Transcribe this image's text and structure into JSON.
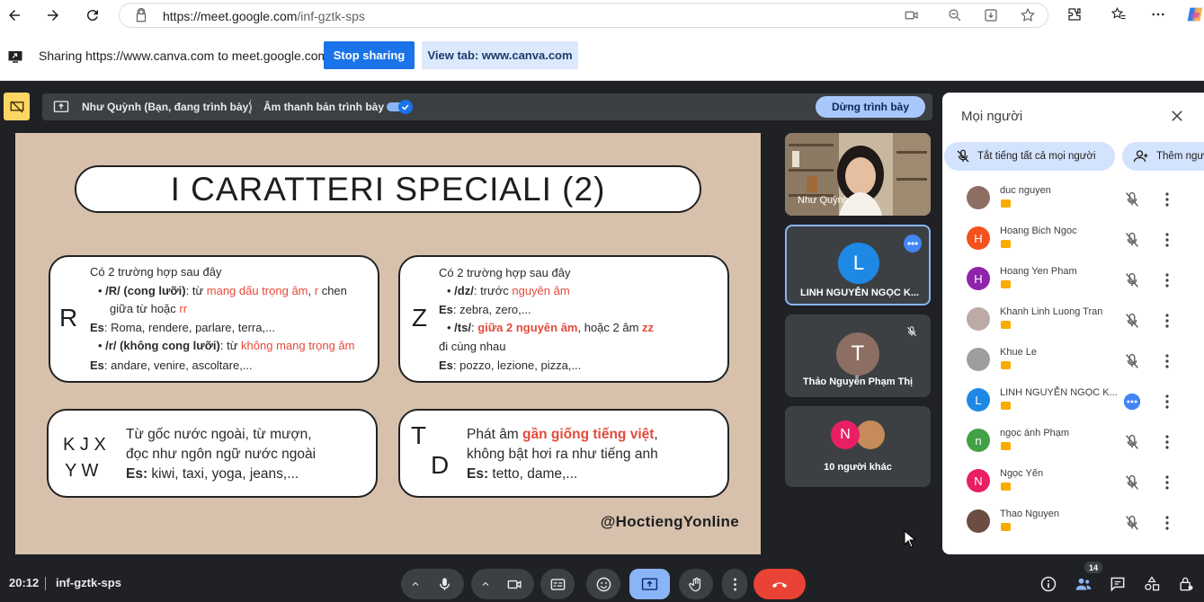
{
  "browser": {
    "url_host": "https://meet.google.com",
    "url_path": "/inf-gztk-sps"
  },
  "share_bar": {
    "text": "Sharing https://www.canva.com to meet.google.com",
    "stop_label": "Stop sharing",
    "view_label": "View tab: www.canva.com"
  },
  "presentation": {
    "presenter": "Như Quỳnh (Bạn, đang trình bày)",
    "audio_label": "Âm thanh bản trình bày",
    "audio_on": true,
    "stop_label": "Dừng trình bày"
  },
  "slide": {
    "title": "I CARATTERI SPECIALI (2)",
    "r": {
      "letter": "R",
      "line1": "Có 2 trường hợp sau đây",
      "b1_bold": "/R/ (cong lưỡi)",
      "b1_a": ": từ ",
      "b1_red1": "mang dấu trọng âm",
      "b1_b": ", ",
      "b1_red2": "r",
      "b1_c": " chen",
      "b1_d": "giữa từ hoặc ",
      "b1_red3": "rr",
      "es1_label": "Es",
      "es1_text": ": Roma, rendere, parlare, terra,...",
      "b2_bold": "/r/ (không cong lưỡi)",
      "b2_a": ": từ ",
      "b2_red": "không mang trọng âm",
      "es2_label": "Es",
      "es2_text": ": andare, venire, ascoltare,..."
    },
    "z": {
      "letter": "Z",
      "line1": "Có 2 trường hợp sau đây",
      "b1_bold": "/dz/",
      "b1_a": ": trước ",
      "b1_red": "nguyên âm",
      "es1_label": "Es",
      "es1_text": ": zebra, zero,...",
      "b2_bold": "/ts/",
      "b2_a": ": ",
      "b2_red1": "giữa 2 nguyên âm",
      "b2_b": ", hoặc 2 âm ",
      "b2_red2": "zz",
      "b2_c": "đi cùng nhau",
      "es2_label": "Es",
      "es2_text": ": pozzo, lezione, pizza,..."
    },
    "kjxyw": {
      "letters1": "K J X",
      "letters2": "Y W",
      "line1": "Từ gốc nước ngoài, từ mượn,",
      "line2": "đọc như ngôn ngữ nước ngoài",
      "es_label": "Es:",
      "es_text": " kiwi, taxi, yoga, jeans,..."
    },
    "td": {
      "letter1": "T",
      "letter2": "D",
      "line1_a": "Phát âm ",
      "line1_red": "gần giống tiếng việt",
      "line1_b": ",",
      "line2": "không bật hơi ra như tiếng anh",
      "es_label": "Es:",
      "es_text": " tetto, dame,..."
    },
    "handle": "@HoctiengYonline"
  },
  "tiles": {
    "t1_name": "Như Quỳnh",
    "t2_initial": "L",
    "t2_name": "LINH NGUYỄN NGỌC K...",
    "t3_initial": "T",
    "t3_name": "Thảo Nguyễn Phạm Thị",
    "t4_initial": "N",
    "t4_name": "10 người khác"
  },
  "people": {
    "title": "Mọi người",
    "mute_all": "Tắt tiếng tất cả mọi người",
    "add": "Thêm ngư",
    "list": [
      {
        "name": "duc nguyen",
        "initial": "",
        "color": "#8d6e63"
      },
      {
        "name": "Hoang Bich Ngoc",
        "initial": "H",
        "color": "#f4511e"
      },
      {
        "name": "Hoang Yen Pham",
        "initial": "H",
        "color": "#8e24aa"
      },
      {
        "name": "Khanh Linh Luong Tran",
        "initial": "",
        "color": "#bcaaa4"
      },
      {
        "name": "Khue Le",
        "initial": "",
        "color": "#9e9e9e"
      },
      {
        "name": "LINH NGUYỄN NGỌC K...",
        "initial": "L",
        "color": "#1e88e5"
      },
      {
        "name": "ngọc ánh Phạm",
        "initial": "n",
        "color": "#43a047"
      },
      {
        "name": "Ngọc Yến",
        "initial": "N",
        "color": "#e91e63"
      },
      {
        "name": "Thao Nguyen",
        "initial": "",
        "color": "#6d4c41"
      }
    ]
  },
  "bottom": {
    "time": "20:12",
    "code": "inf-gztk-sps",
    "participant_count": "14"
  }
}
